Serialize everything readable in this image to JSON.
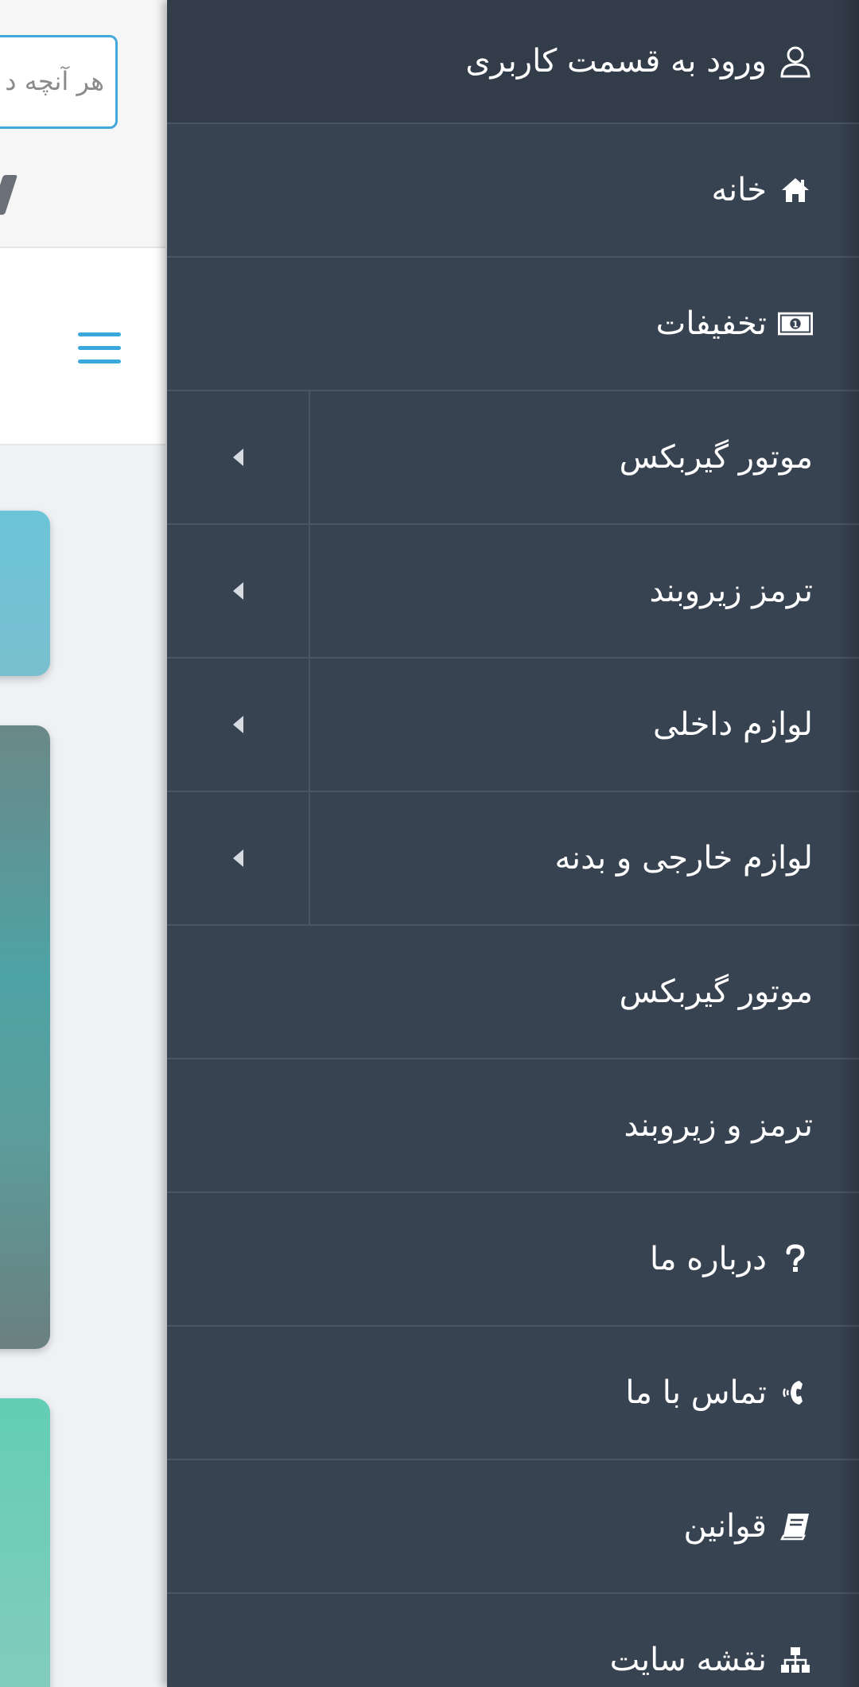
{
  "background_page": {
    "search_placeholder": "هر آنچه د"
  },
  "drawer": {
    "login_label": "ورود به قسمت کاربری",
    "items": [
      {
        "label": "خانه",
        "icon": "home-icon",
        "submenu": false
      },
      {
        "label": "تخفیفات",
        "icon": "money-bill-icon",
        "submenu": false
      },
      {
        "label": "موتور گیربکس",
        "icon": "",
        "submenu": true
      },
      {
        "label": "ترمز زیروبند",
        "icon": "",
        "submenu": true
      },
      {
        "label": "لوازم داخلی",
        "icon": "",
        "submenu": true
      },
      {
        "label": "لوازم خارجی و بدنه",
        "icon": "",
        "submenu": true
      },
      {
        "label": "موتور گیربکس",
        "icon": "",
        "submenu": false
      },
      {
        "label": "ترمز و زیروبند",
        "icon": "",
        "submenu": false
      },
      {
        "label": "درباره ما",
        "icon": "question-icon",
        "submenu": false
      },
      {
        "label": "تماس با ما",
        "icon": "phone-volume-icon",
        "submenu": false
      },
      {
        "label": "قوانین",
        "icon": "book-icon",
        "submenu": false
      },
      {
        "label": "نقشه سایت",
        "icon": "sitemap-icon",
        "submenu": false
      }
    ]
  },
  "colors": {
    "drawer_bg": "#384351",
    "login_bg": "#333d4a",
    "divider": "#4b5665",
    "accent": "#3aa7dd"
  }
}
